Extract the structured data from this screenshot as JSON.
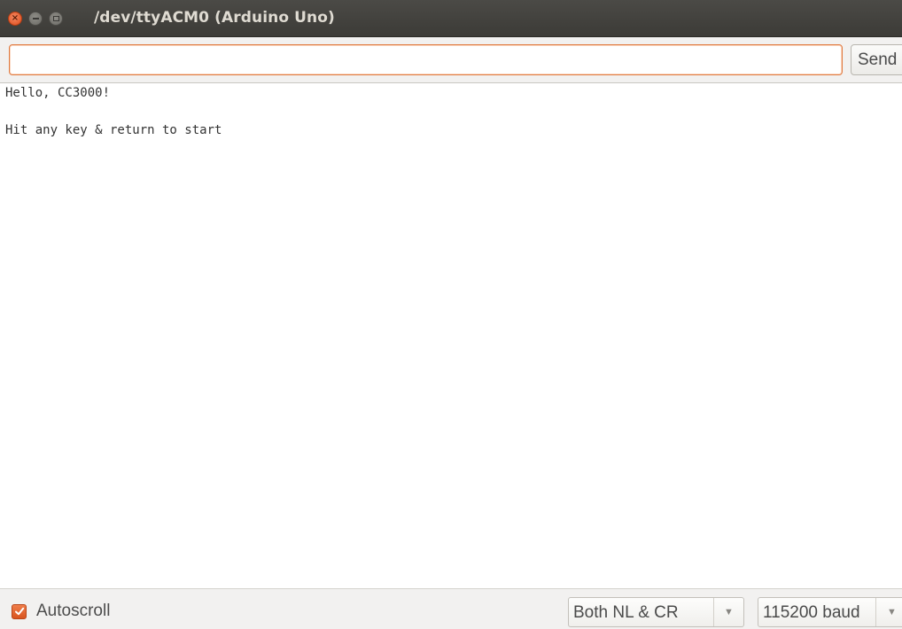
{
  "window": {
    "title": "/dev/ttyACM0 (Arduino Uno)",
    "close_glyph": "×"
  },
  "send": {
    "input_value": "",
    "button_label": "Send"
  },
  "output": {
    "lines": [
      "Hello, CC3000!",
      "Hit any key & return to start"
    ]
  },
  "footer": {
    "autoscroll_label": "Autoscroll",
    "autoscroll_checked": true,
    "line_ending": "Both NL & CR",
    "baud_rate": "115200 baud",
    "dropdown_glyph": "▼"
  },
  "colors": {
    "accent": "#e0622b",
    "titlebar": "#3c3b37",
    "toolbar_bg": "#f2f1f0"
  }
}
